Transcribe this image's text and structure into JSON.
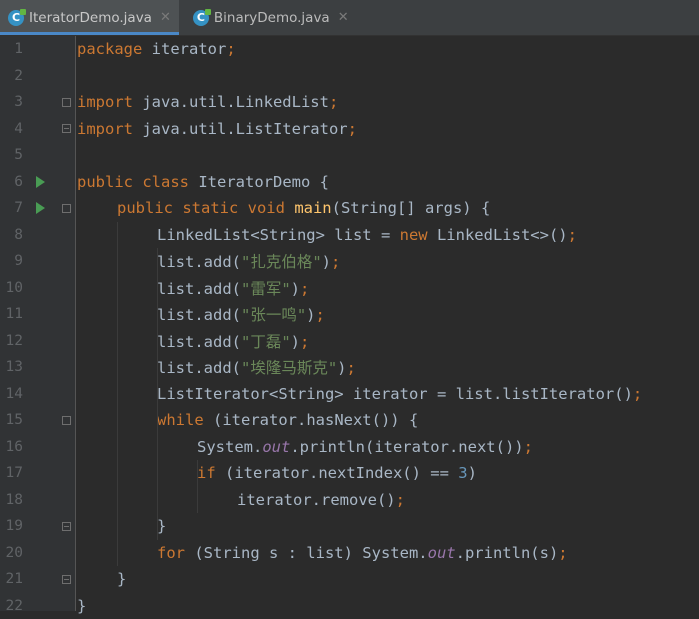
{
  "tabs": [
    {
      "label": "IteratorDemo.java",
      "active": true,
      "icon": "java-class-icon"
    },
    {
      "label": "BinaryDemo.java",
      "active": false,
      "icon": "java-class-icon"
    }
  ],
  "close_glyph": "✕",
  "code_lines": [
    {
      "n": "1",
      "run": false,
      "fold": "",
      "indent": 0,
      "tokens": [
        [
          "kw",
          "package "
        ],
        [
          "t",
          "iterator"
        ],
        [
          "kw",
          ";"
        ]
      ]
    },
    {
      "n": "2",
      "run": false,
      "fold": "",
      "indent": 0,
      "tokens": []
    },
    {
      "n": "3",
      "run": false,
      "fold": "open",
      "indent": 0,
      "tokens": [
        [
          "kw",
          "import "
        ],
        [
          "t",
          "java.util.LinkedList"
        ],
        [
          "kw",
          ";"
        ]
      ]
    },
    {
      "n": "4",
      "run": false,
      "fold": "close",
      "indent": 0,
      "tokens": [
        [
          "kw",
          "import "
        ],
        [
          "t",
          "java.util.ListIterator"
        ],
        [
          "kw",
          ";"
        ]
      ]
    },
    {
      "n": "5",
      "run": false,
      "fold": "",
      "indent": 0,
      "tokens": []
    },
    {
      "n": "6",
      "run": true,
      "fold": "",
      "indent": 0,
      "tokens": [
        [
          "kw",
          "public class "
        ],
        [
          "t",
          "IteratorDemo {"
        ]
      ]
    },
    {
      "n": "7",
      "run": true,
      "fold": "open",
      "indent": 1,
      "tokens": [
        [
          "kw",
          "public static void "
        ],
        [
          "fn",
          "main"
        ],
        [
          "t",
          "(String[] args) {"
        ]
      ]
    },
    {
      "n": "8",
      "run": false,
      "fold": "",
      "indent": 2,
      "tokens": [
        [
          "t",
          "LinkedList<String> list = "
        ],
        [
          "kw",
          "new "
        ],
        [
          "t",
          "LinkedList<>()"
        ],
        [
          "kw",
          ";"
        ]
      ]
    },
    {
      "n": "9",
      "run": false,
      "fold": "",
      "indent": 2,
      "tokens": [
        [
          "t",
          "list.add("
        ],
        [
          "str",
          "\"扎克伯格\""
        ],
        [
          "t",
          ")"
        ],
        [
          "kw",
          ";"
        ]
      ]
    },
    {
      "n": "10",
      "run": false,
      "fold": "",
      "indent": 2,
      "tokens": [
        [
          "t",
          "list.add("
        ],
        [
          "str",
          "\"雷军\""
        ],
        [
          "t",
          ")"
        ],
        [
          "kw",
          ";"
        ]
      ]
    },
    {
      "n": "11",
      "run": false,
      "fold": "",
      "indent": 2,
      "tokens": [
        [
          "t",
          "list.add("
        ],
        [
          "str",
          "\"张一鸣\""
        ],
        [
          "t",
          ")"
        ],
        [
          "kw",
          ";"
        ]
      ]
    },
    {
      "n": "12",
      "run": false,
      "fold": "",
      "indent": 2,
      "tokens": [
        [
          "t",
          "list.add("
        ],
        [
          "str",
          "\"丁磊\""
        ],
        [
          "t",
          ")"
        ],
        [
          "kw",
          ";"
        ]
      ]
    },
    {
      "n": "13",
      "run": false,
      "fold": "",
      "indent": 2,
      "tokens": [
        [
          "t",
          "list.add("
        ],
        [
          "str",
          "\"埃隆马斯克\""
        ],
        [
          "t",
          ")"
        ],
        [
          "kw",
          ";"
        ]
      ]
    },
    {
      "n": "14",
      "run": false,
      "fold": "",
      "indent": 2,
      "tokens": [
        [
          "t",
          "ListIterator<String> iterator = list.listIterator()"
        ],
        [
          "kw",
          ";"
        ]
      ]
    },
    {
      "n": "15",
      "run": false,
      "fold": "open",
      "indent": 2,
      "tokens": [
        [
          "kw",
          "while "
        ],
        [
          "t",
          "(iterator.hasNext()) {"
        ]
      ]
    },
    {
      "n": "16",
      "run": false,
      "fold": "",
      "indent": 3,
      "tokens": [
        [
          "t",
          "System."
        ],
        [
          "fld",
          "out"
        ],
        [
          "t",
          ".println(iterator.next())"
        ],
        [
          "kw",
          ";"
        ]
      ]
    },
    {
      "n": "17",
      "run": false,
      "fold": "",
      "indent": 3,
      "tokens": [
        [
          "kw",
          "if "
        ],
        [
          "t",
          "(iterator.nextIndex() == "
        ],
        [
          "num",
          "3"
        ],
        [
          "t",
          ")"
        ]
      ]
    },
    {
      "n": "18",
      "run": false,
      "fold": "",
      "indent": 4,
      "tokens": [
        [
          "t",
          "iterator.remove()"
        ],
        [
          "kw",
          ";"
        ]
      ]
    },
    {
      "n": "19",
      "run": false,
      "fold": "close",
      "indent": 2,
      "tokens": [
        [
          "t",
          "}"
        ]
      ]
    },
    {
      "n": "20",
      "run": false,
      "fold": "",
      "indent": 2,
      "tokens": [
        [
          "kw",
          "for "
        ],
        [
          "t",
          "(String s : list) System."
        ],
        [
          "fld",
          "out"
        ],
        [
          "t",
          ".println(s)"
        ],
        [
          "kw",
          ";"
        ]
      ]
    },
    {
      "n": "21",
      "run": false,
      "fold": "close",
      "indent": 1,
      "tokens": [
        [
          "t",
          "}"
        ]
      ]
    },
    {
      "n": "22",
      "run": false,
      "fold": "",
      "indent": 0,
      "tokens": [
        [
          "t",
          "}"
        ]
      ]
    }
  ]
}
